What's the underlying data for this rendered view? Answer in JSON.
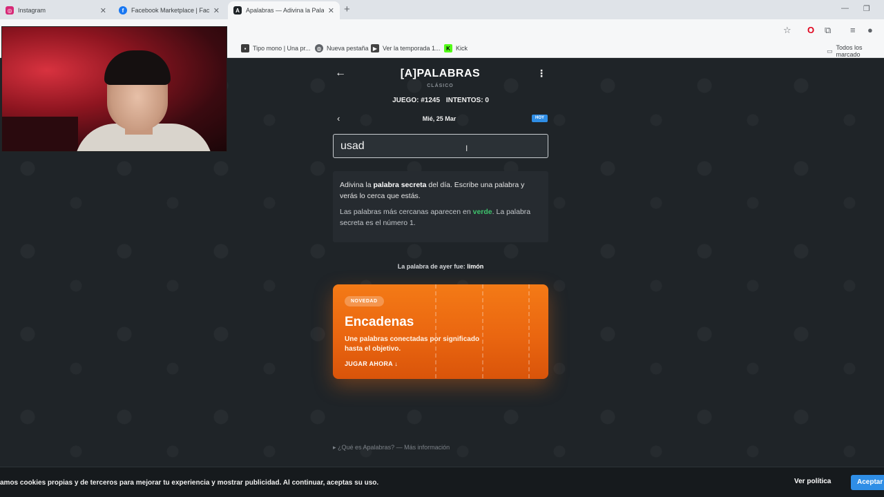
{
  "browser": {
    "tabs": [
      {
        "title": "Instagram",
        "icon": "instagram-icon",
        "color": "#d62976"
      },
      {
        "title": "Facebook Marketplace | Facebo",
        "icon": "facebook-icon",
        "color": "#1877f2"
      },
      {
        "title": "Apalabras — Adivina la Palabra",
        "icon": "apalabras-icon",
        "color": "#1e2327"
      }
    ],
    "bookmarks": [
      {
        "label": "Tipo mono | Una pr...",
        "icon": "tipo-mono-icon",
        "color": "#3c3c3c"
      },
      {
        "label": "Nueva pestaña",
        "icon": "globe-icon",
        "color": "#5f6368"
      },
      {
        "label": "Ver la temporada 1...",
        "icon": "video-icon",
        "color": "#444"
      },
      {
        "label": "Kick",
        "icon": "kick-icon",
        "color": "#53fc18"
      }
    ],
    "all_bookmarks": "Todos los marcado"
  },
  "app": {
    "title": "[A]PALABRAS",
    "subtitle": "CLÁSICO",
    "game_label": "JUEGO: #1245",
    "attempts_label": "INTENTOS: 0",
    "date": "Mié, 25 Mar",
    "today_badge": "HOY"
  },
  "guess": {
    "value": "usad"
  },
  "info": {
    "p1_a": "Adivina la ",
    "p1_b": "palabra secreta",
    "p1_c": " del día. Escribe una palabra y verás lo cerca que estás.",
    "p2_a": "Las palabras más cercanas aparecen en ",
    "p2_b": "verde",
    "p2_c": ". La palabra secreta es el número 1."
  },
  "yesterday": {
    "label": "La palabra de ayer fue: ",
    "word": "limón"
  },
  "promo": {
    "badge": "NOVEDAD",
    "title": "Encadenas",
    "desc": "Une palabras conectadas por significado hasta el objetivo.",
    "cta": "JUGAR AHORA ↓",
    "accent": "#f47a16"
  },
  "footer": {
    "more_info": "▸ ¿Qué es Apalabras? — Más información"
  },
  "cookies": {
    "text": "amos cookies propias y de terceros para mejorar tu experiencia y mostrar publicidad. Al continuar, aceptas su uso.",
    "policy": "Ver política",
    "accept": "Aceptar"
  },
  "colors": {
    "background": "#1f2428",
    "accent_blue": "#2f8ee6",
    "green": "#3ec46d"
  }
}
